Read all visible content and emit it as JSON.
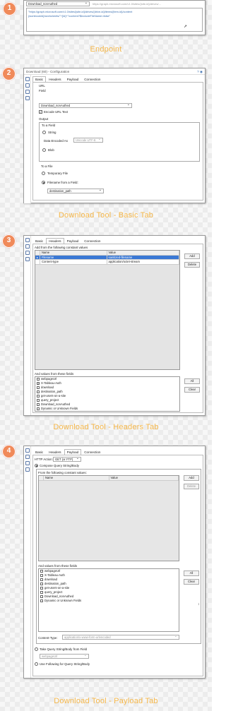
{
  "captions": {
    "endpoint": "Endpoint",
    "basic": "Download Tool - Basic Tab",
    "headers": "Download Tool - Headers Tab",
    "payload": "Download Tool - Payload Tab"
  },
  "steps": [
    "1",
    "2",
    "3",
    "4"
  ],
  "endpoint": {
    "field_value": "Download_nonAuthed",
    "url_line1": "\"https://graph.microsoft.com/v1.0/sites/{site-id}/drives/{drive-id}/items/{item-id}/content",
    "url_line2": "{workbookId}/worksheets/\"+[Id]+\"/content?$includeFileName=false\"",
    "url_top": "https://graph.microsoft.com/v1.0/sites/{site-id}/drives/..."
  },
  "basic_window": {
    "title": "Download (60) - Configuration",
    "tabs": [
      "Basic",
      "Headers",
      "Payload",
      "Connection"
    ],
    "url_group": "URL",
    "field_label": "Field",
    "field_value": "Download_nonAuthed",
    "encode_url": "Encode URL Text",
    "output_group": "Output",
    "to_field": "To a Field",
    "string": "String",
    "data_encoded_as": "Data Encoded As",
    "encoding_value": "Unicode UTF-8",
    "blob": "Blob",
    "to_file": "To a File",
    "temporary_file": "Temporary File",
    "filename_from_field": "Filename from a Field:",
    "path_value": "destination_path"
  },
  "headers_window": {
    "tabs": [
      "Basic",
      "Headers",
      "Payload",
      "Connection"
    ],
    "add_constant": "Add from the following constant values",
    "columns": [
      "Name",
      "Value"
    ],
    "rows": [
      {
        "name": "Filename",
        "value": "sanitized-filename"
      },
      {
        "name": "Content-type",
        "value": "application/octet-stream"
      }
    ],
    "add_btn": "Add",
    "delete_btn": "Delete",
    "add_fields": "And values from these fields",
    "fields": [
      "webpageUrl",
      "X-Tableau-Auth",
      "download",
      "destination_path",
      "get-users-on-a-site",
      "query_project",
      "Download_nonAuthed",
      "Dynamic or Unknown Fields"
    ],
    "checked": [
      false,
      true,
      false,
      false,
      false,
      false,
      false,
      false
    ],
    "all_btn": "All",
    "clear_btn": "Clear"
  },
  "payload_window": {
    "tabs": [
      "Basic",
      "Headers",
      "Payload",
      "Connection"
    ],
    "http_action_label": "HTTP Action:",
    "http_action_value": "GET (or FTP)",
    "compose": "Compose Query String/Body",
    "from_constant": "From the following constant values:",
    "columns": [
      "Name",
      "Value"
    ],
    "add_btn": "Add",
    "delete_btn": "Delete",
    "and_values": "And values from these fields",
    "fields": [
      "webpageUrl",
      "X-Tableau-Auth",
      "download",
      "destination_path",
      "get-users-on-a-site",
      "query_project",
      "Download_nonAuthed",
      "Dynamic or Unknown Fields"
    ],
    "all_btn": "All",
    "clear_btn": "Clear",
    "content_type_label": "Content-Type:",
    "content_type_value": "application/x-www-form-urlencoded",
    "take_query": "Take Query String/Body from Field",
    "take_query_value": "webpageUrl",
    "use_following": "Use Following for Query String/Body"
  }
}
